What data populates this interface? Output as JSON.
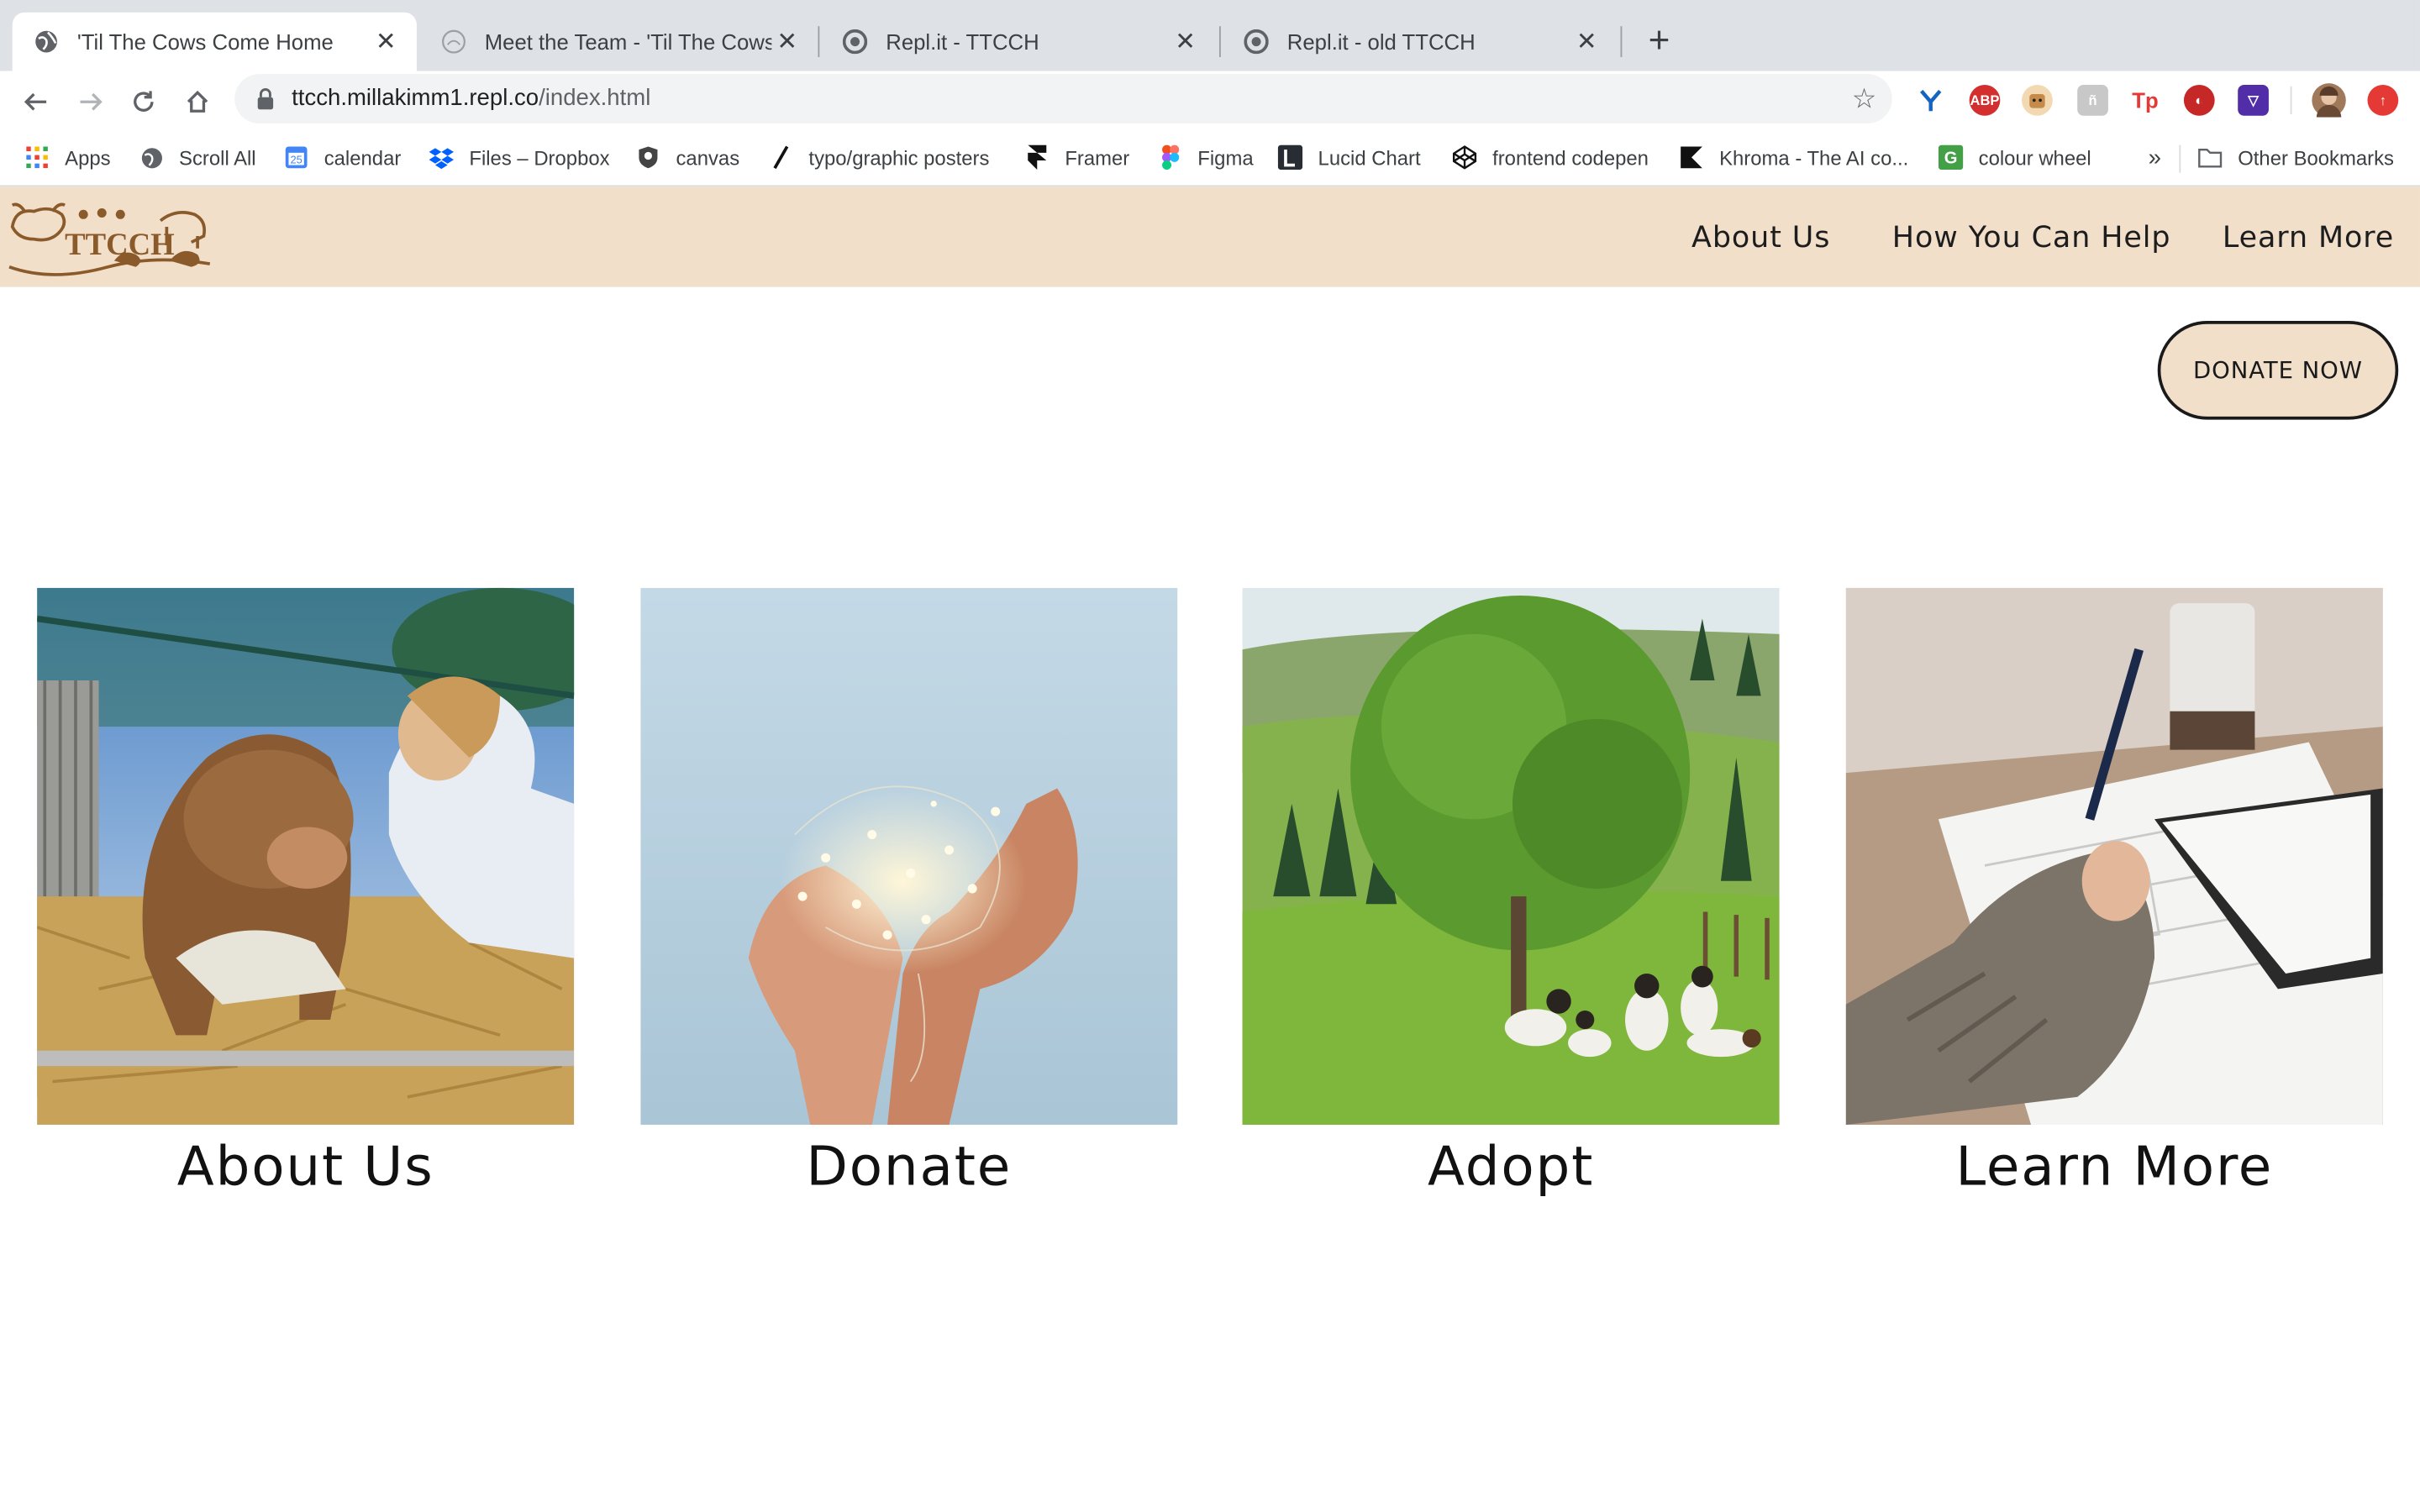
{
  "browser": {
    "tabs": [
      {
        "title": "'Til The Cows Come Home",
        "active": true,
        "icon": "globe-icon"
      },
      {
        "title": "Meet the Team - 'Til The Cows C",
        "active": false,
        "icon": "page-icon"
      },
      {
        "title": "Repl.it - TTCCH",
        "active": false,
        "icon": "replit-icon"
      },
      {
        "title": "Repl.it - old TTCCH",
        "active": false,
        "icon": "replit-icon"
      }
    ],
    "url_host": "ttcch.millakimm1.repl.co",
    "url_path": "/index.html",
    "bookmarks": [
      {
        "label": "Apps",
        "icon": "apps-grid-icon"
      },
      {
        "label": "Scroll All",
        "icon": "globe-icon"
      },
      {
        "label": "calendar",
        "icon": "calendar-icon"
      },
      {
        "label": "Files – Dropbox",
        "icon": "dropbox-icon"
      },
      {
        "label": "canvas",
        "icon": "shield-icon"
      },
      {
        "label": "typo/graphic posters",
        "icon": "slash-icon"
      },
      {
        "label": "Framer",
        "icon": "framer-icon"
      },
      {
        "label": "Figma",
        "icon": "figma-icon"
      },
      {
        "label": "Lucid Chart",
        "icon": "lucid-icon"
      },
      {
        "label": "frontend codepen",
        "icon": "codepen-icon"
      },
      {
        "label": "Khroma - The AI co...",
        "icon": "khroma-icon"
      },
      {
        "label": "colour wheel",
        "icon": "g-icon"
      }
    ],
    "overflow_label": "»",
    "other_bookmarks": "Other Bookmarks"
  },
  "site": {
    "logo_text": "TTCCH",
    "nav": [
      "About Us",
      "How You Can Help",
      "Learn More"
    ],
    "donate_button": "DONATE NOW",
    "cards": [
      {
        "label": "About Us"
      },
      {
        "label": "Donate"
      },
      {
        "label": "Adopt"
      },
      {
        "label": "Learn More"
      }
    ]
  },
  "colors": {
    "header_bg": "#f1dfca",
    "logo_brown": "#8a5a2b",
    "tabstrip": "#dee1e6"
  }
}
